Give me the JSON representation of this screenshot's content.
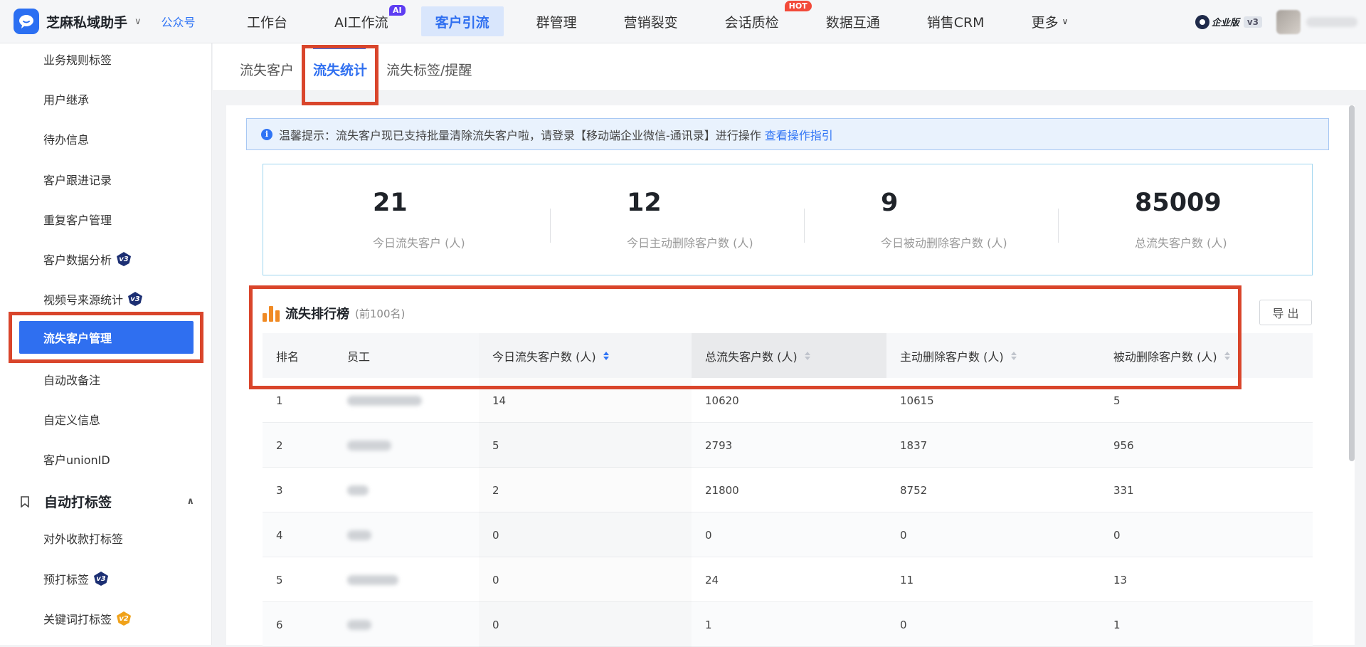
{
  "brand": {
    "name": "芝麻私域助手",
    "caret": "∨",
    "link": "公众号"
  },
  "topnav": [
    {
      "label": "工作台",
      "active": false,
      "badge": ""
    },
    {
      "label": "AI工作流",
      "active": false,
      "badge": "AI"
    },
    {
      "label": "客户引流",
      "active": true,
      "badge": ""
    },
    {
      "label": "群管理",
      "active": false,
      "badge": ""
    },
    {
      "label": "营销裂变",
      "active": false,
      "badge": ""
    },
    {
      "label": "会话质检",
      "active": false,
      "badge": "HOT"
    },
    {
      "label": "数据互通",
      "active": false,
      "badge": ""
    },
    {
      "label": "销售CRM",
      "active": false,
      "badge": ""
    },
    {
      "label": "更多",
      "active": false,
      "badge": ""
    }
  ],
  "edition": {
    "label": "企业版",
    "version": "v3"
  },
  "sidebar": {
    "items": [
      {
        "label": "业务规则标签",
        "badge": ""
      },
      {
        "label": "用户继承",
        "badge": ""
      },
      {
        "label": "待办信息",
        "badge": ""
      },
      {
        "label": "客户跟进记录",
        "badge": ""
      },
      {
        "label": "重复客户管理",
        "badge": ""
      },
      {
        "label": "客户数据分析",
        "badge": "v3"
      },
      {
        "label": "视频号来源统计",
        "badge": "v3"
      },
      {
        "label": "自动改备注",
        "badge": ""
      },
      {
        "label": "自定义信息",
        "badge": ""
      },
      {
        "label": "客户unionID",
        "badge": ""
      },
      {
        "label": "对外收款打标签",
        "badge": ""
      },
      {
        "label": "预打标签",
        "badge": "v3"
      },
      {
        "label": "关键词打标签",
        "badge": "v2"
      }
    ],
    "active": "流失客户管理",
    "group": "自动打标签"
  },
  "subtabs": [
    {
      "label": "流失客户",
      "active": false
    },
    {
      "label": "流失统计",
      "active": true
    },
    {
      "label": "流失标签/提醒",
      "active": false
    }
  ],
  "notice": {
    "icon": "i",
    "text": "温馨提示：流失客户现已支持批量清除流失客户啦，请登录【移动端企业微信-通讯录】进行操作",
    "link": "查看操作指引"
  },
  "stats": [
    {
      "value": "21",
      "label": "今日流失客户 (人)"
    },
    {
      "value": "12",
      "label": "今日主动删除客户数 (人)"
    },
    {
      "value": "9",
      "label": "今日被动删除客户数 (人)"
    },
    {
      "value": "85009",
      "label": "总流失客户数 (人)"
    }
  ],
  "ranking": {
    "title": "流失排行榜",
    "subtitle": "(前100名)",
    "export": "导 出",
    "columns": [
      "排名",
      "员工",
      "今日流失客户数 (人)",
      "总流失客户数 (人)",
      "主动删除客户数 (人)",
      "被动删除客户数 (人)"
    ],
    "rows": [
      {
        "rank": "1",
        "today": "14",
        "total": "10620",
        "active": "10615",
        "passive": "5"
      },
      {
        "rank": "2",
        "today": "5",
        "total": "2793",
        "active": "1837",
        "passive": "956"
      },
      {
        "rank": "3",
        "today": "2",
        "total": "21800",
        "active": "8752",
        "passive": "331"
      },
      {
        "rank": "4",
        "today": "0",
        "total": "0",
        "active": "0",
        "passive": "0"
      },
      {
        "rank": "5",
        "today": "0",
        "total": "24",
        "active": "11",
        "passive": "13"
      },
      {
        "rank": "6",
        "today": "0",
        "total": "1",
        "active": "0",
        "passive": "1"
      }
    ]
  },
  "colors": {
    "accent": "#2f6ff0",
    "highlight_frame": "#d9452b",
    "rank_icon": "#f08a24"
  }
}
